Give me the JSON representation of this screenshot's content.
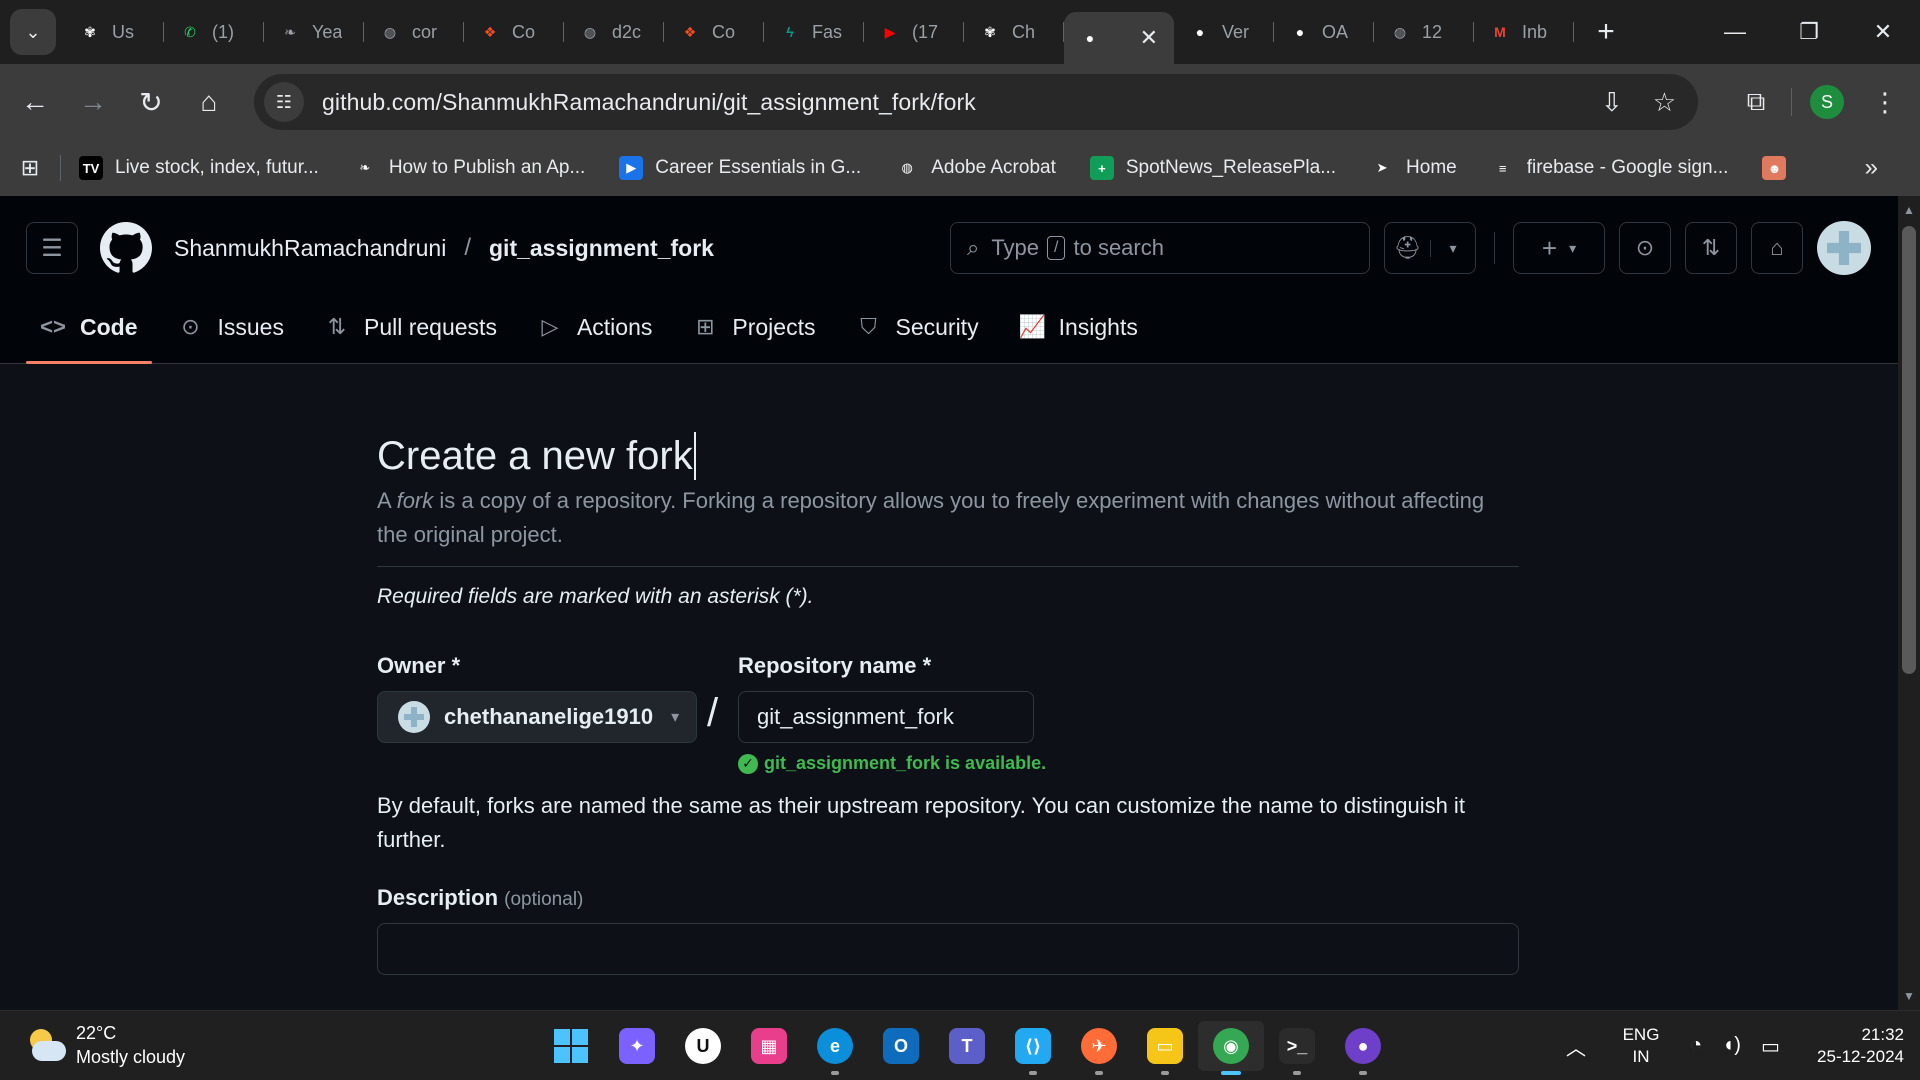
{
  "browser": {
    "tabs": [
      {
        "title": "Us",
        "icon": "openai-icon",
        "color": "#ffffff"
      },
      {
        "title": "(1)",
        "icon": "whatsapp-icon",
        "color": "#25d366"
      },
      {
        "title": "Yea",
        "icon": "feather-icon",
        "color": "#9aa0a6"
      },
      {
        "title": "cor",
        "icon": "globe-icon",
        "color": "#9aa0a6"
      },
      {
        "title": "Co",
        "icon": "figma-icon",
        "color": "#f24e1e"
      },
      {
        "title": "d2c",
        "icon": "globe-icon",
        "color": "#9aa0a6"
      },
      {
        "title": "Co",
        "icon": "figma-icon",
        "color": "#f24e1e"
      },
      {
        "title": "Fas",
        "icon": "fastapi-icon",
        "color": "#05998b"
      },
      {
        "title": "(17",
        "icon": "youtube-icon",
        "color": "#ff0000"
      },
      {
        "title": "Ch",
        "icon": "openai-icon",
        "color": "#ffffff"
      },
      {
        "title": "",
        "icon": "github-icon",
        "color": "#ffffff",
        "active": true
      },
      {
        "title": "Ver",
        "icon": "github-icon",
        "color": "#ffffff"
      },
      {
        "title": "OA",
        "icon": "github-icon",
        "color": "#ffffff"
      },
      {
        "title": "12",
        "icon": "globe-icon",
        "color": "#9aa0a6"
      },
      {
        "title": "Inb",
        "icon": "gmail-icon",
        "color": "#ea4335"
      }
    ],
    "url": "github.com/ShanmukhRamachandruni/git_assignment_fork/fork",
    "profile_initial": "S",
    "bookmarks": [
      {
        "label": "Live stock, index, futur...",
        "icon": "tradingview-icon",
        "color": "#000000"
      },
      {
        "label": "How to Publish an Ap...",
        "icon": "feather-icon",
        "color": "#3c3c3c"
      },
      {
        "label": "Career Essentials in G...",
        "icon": "video-icon",
        "color": "#1a73e8"
      },
      {
        "label": "Adobe Acrobat",
        "icon": "globe-icon",
        "color": "#3c3c3c"
      },
      {
        "label": "SpotNews_ReleasePla...",
        "icon": "sheets-icon",
        "color": "#0f9d58"
      },
      {
        "label": "Home",
        "icon": "arrow-icon",
        "color": "#3c3c3c"
      },
      {
        "label": "firebase - Google sign...",
        "icon": "stackoverflow-icon",
        "color": "#3c3c3c"
      },
      {
        "label": "",
        "icon": "avatar-icon",
        "color": "#e07a5f"
      }
    ]
  },
  "github": {
    "owner": "ShanmukhRamachandruni",
    "repo": "git_assignment_fork",
    "search_placeholder_pre": "Type",
    "search_key": "/",
    "search_placeholder_post": "to search",
    "nav": [
      {
        "label": "Code",
        "icon": "code-icon",
        "glyph": "<>",
        "active": true
      },
      {
        "label": "Issues",
        "icon": "issue-icon",
        "glyph": "⊙"
      },
      {
        "label": "Pull requests",
        "icon": "pull-request-icon",
        "glyph": "⇅"
      },
      {
        "label": "Actions",
        "icon": "play-icon",
        "glyph": "▷"
      },
      {
        "label": "Projects",
        "icon": "table-icon",
        "glyph": "⊞"
      },
      {
        "label": "Security",
        "icon": "shield-icon",
        "glyph": "⛉"
      },
      {
        "label": "Insights",
        "icon": "graph-icon",
        "glyph": "📈"
      }
    ]
  },
  "form": {
    "title": "Create a new fork",
    "subtitle_pre": "A ",
    "subtitle_em": "fork",
    "subtitle_post": " is a copy of a repository. Forking a repository allows you to freely experiment with changes without affecting the original project.",
    "required_note": "Required fields are marked with an asterisk (*).",
    "owner_label": "Owner *",
    "owner_value": "chethananelige1910",
    "repo_label": "Repository name *",
    "repo_value": "git_assignment_fork",
    "available_msg": "git_assignment_fork is available.",
    "help_text": "By default, forks are named the same as their upstream repository. You can customize the name to distinguish it further.",
    "desc_label": "Description",
    "desc_optional": "(optional)",
    "desc_value": ""
  },
  "taskbar": {
    "temperature": "22°C",
    "weather": "Mostly cloudy",
    "apps": [
      {
        "name": "start",
        "color": "#4cc2ff"
      },
      {
        "name": "copilot",
        "color": "#7b61ff"
      },
      {
        "name": "u-app",
        "color": "#ffffff"
      },
      {
        "name": "calendar-app",
        "color": "#e83e8c"
      },
      {
        "name": "edge",
        "color": "#0c8fdb"
      },
      {
        "name": "outlook",
        "color": "#0f6cbd"
      },
      {
        "name": "teams",
        "color": "#5b5fc7"
      },
      {
        "name": "vscode",
        "color": "#23a9f2"
      },
      {
        "name": "postman",
        "color": "#ff6c37"
      },
      {
        "name": "file-explorer",
        "color": "#f5c518"
      },
      {
        "name": "chrome",
        "color": "#34a853",
        "active": true
      },
      {
        "name": "terminal",
        "color": "#2b2b2b"
      },
      {
        "name": "github-desktop",
        "color": "#6e40c9"
      }
    ],
    "lang_top": "ENG",
    "lang_bottom": "IN",
    "time": "21:32",
    "date": "25-12-2024"
  },
  "colors": {
    "accent_tab_underline": "#f78166",
    "success": "#3fb950",
    "page_bg": "#0d1117",
    "header_bg": "#010409"
  }
}
